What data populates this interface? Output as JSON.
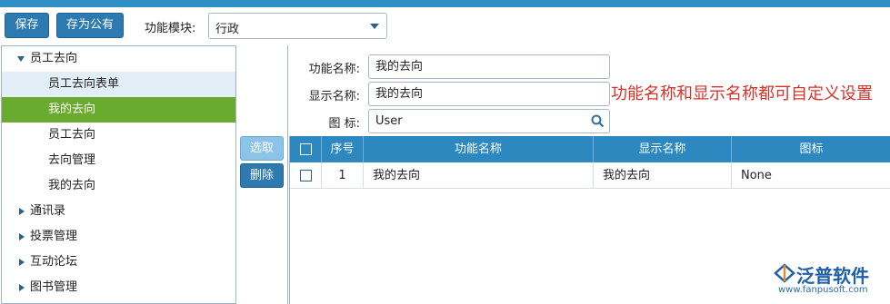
{
  "toolbar": {
    "save_label": "保存",
    "save_public_label": "存为公有",
    "module_label": "功能模块:",
    "module_value": "行政"
  },
  "tree": {
    "items": [
      {
        "label": "员工去向",
        "level": 0,
        "expanded": true
      },
      {
        "label": "员工去向表单",
        "level": 1
      },
      {
        "label": "我的去向",
        "level": 1,
        "selected": true
      },
      {
        "label": "员工去向",
        "level": 1
      },
      {
        "label": "去向管理",
        "level": 1
      },
      {
        "label": "我的去向",
        "level": 1
      },
      {
        "label": "通讯录",
        "level": 0,
        "expanded": false
      },
      {
        "label": "投票管理",
        "level": 0,
        "expanded": false
      },
      {
        "label": "互动论坛",
        "level": 0,
        "expanded": false
      },
      {
        "label": "图书管理",
        "level": 0,
        "expanded": false
      }
    ]
  },
  "side_buttons": {
    "select_label": "选取",
    "delete_label": "删除"
  },
  "form": {
    "func_name_label": "功能名称:",
    "func_name_value": "我的去向",
    "display_name_label": "显示名称:",
    "display_name_value": "我的去向",
    "icon_label": "图 标:",
    "icon_value": "User"
  },
  "annotation": "功能名称和显示名称都可自定义设置",
  "grid": {
    "headers": [
      "序号",
      "功能名称",
      "显示名称",
      "图标"
    ],
    "rows": [
      {
        "index": "1",
        "func_name": "我的去向",
        "display_name": "我的去向",
        "icon": "None"
      }
    ]
  },
  "logo": {
    "name": "泛普软件",
    "url": "www.fanpusoft.com"
  },
  "colors": {
    "accent": "#2d88bf",
    "selected": "#6aaa2e",
    "annotation": "#d9322b"
  }
}
